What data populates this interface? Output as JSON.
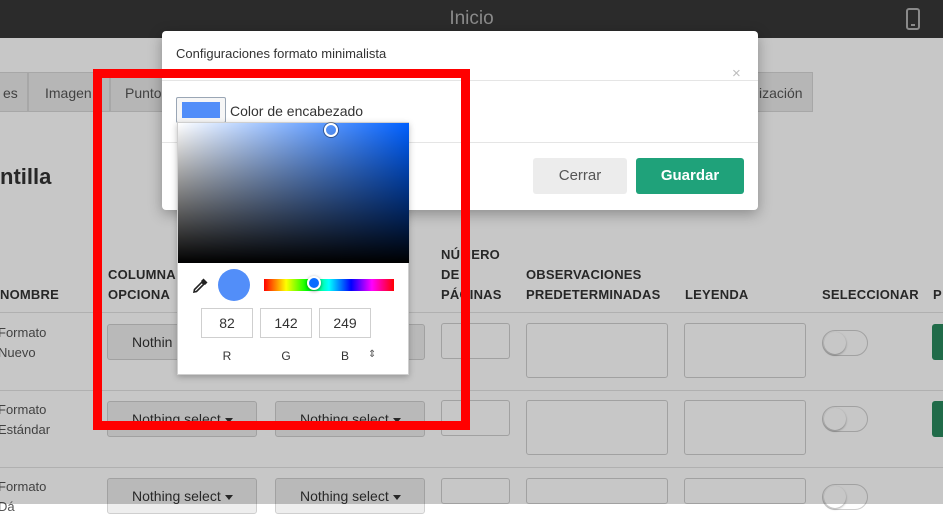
{
  "app": {
    "title": "Inicio"
  },
  "tabs": [
    "es",
    "Imagen",
    "Punto",
    "ización"
  ],
  "section": {
    "title": "ntilla"
  },
  "table": {
    "headers": {
      "nombre": "NOMBRE",
      "columnas": "COLUMNA OPCIONA",
      "paginas": "NÚMERO DE PÁGINAS",
      "observaciones": "OBSERVACIONES PREDETERMINADAS",
      "leyenda": "LEYENDA",
      "seleccionar": "SELECCIONAR",
      "extra": "P"
    },
    "rows": [
      {
        "name": "Formato Nuevo",
        "select1": "Nothin",
        "select2": ""
      },
      {
        "name": "Formato Estándar",
        "select1": "Nothing select",
        "select2": "Nothing select"
      },
      {
        "name": "Formato Dá",
        "select1": "Nothing select",
        "select2": "Nothing select"
      }
    ]
  },
  "modal": {
    "title": "Configuraciones formato minimalista",
    "close_glyph": "×",
    "color_label": "Color de encabezado",
    "close_button": "Cerrar",
    "save_button": "Guardar"
  },
  "picker": {
    "hex": "#528ef9",
    "r": "82",
    "g": "142",
    "b": "249",
    "labels": {
      "r": "R",
      "g": "G",
      "b": "B"
    },
    "mode_toggle_glyph": "⇕"
  },
  "colors": {
    "accent_green": "#1fa27a",
    "annotation": "#ff0000"
  }
}
